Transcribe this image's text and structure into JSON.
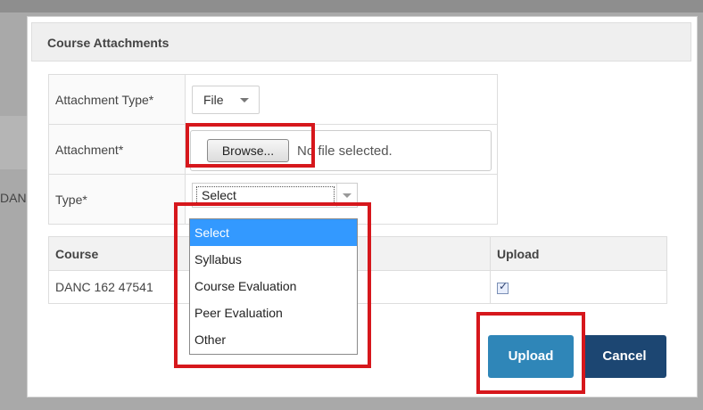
{
  "modal": {
    "title": "Course Attachments",
    "form": {
      "attachment_type_label": "Attachment Type*",
      "attachment_type_value": "File",
      "attachment_label": "Attachment*",
      "browse_label": "Browse...",
      "no_file_text": "No file selected.",
      "type_label": "Type*",
      "type_value": "Select"
    },
    "dropdown": {
      "options": [
        "Select",
        "Syllabus",
        "Course Evaluation",
        "Peer Evaluation",
        "Other"
      ],
      "selected": "Select"
    },
    "course_table": {
      "headers": [
        "Course",
        "Upload"
      ],
      "rows": [
        {
          "course": "DANC 162 47541",
          "upload_checked": true
        }
      ]
    },
    "buttons": {
      "upload": "Upload",
      "cancel": "Cancel"
    }
  },
  "background": {
    "left_fragment": "DAN"
  },
  "colors": {
    "upload_button": "#2f86b8",
    "cancel_button": "#1c4672",
    "highlight": "#d6171c",
    "dropdown_selected": "#3399ff"
  }
}
